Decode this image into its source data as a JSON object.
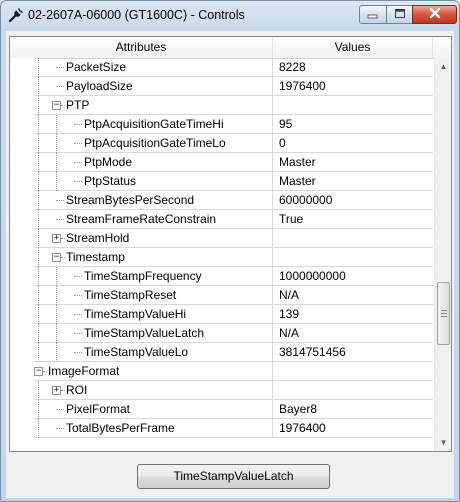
{
  "window": {
    "title": "02-2607A-06000 (GT1600C) - Controls",
    "icon": "wrench-icon",
    "controls": [
      "minimize-icon",
      "maximize-icon",
      "close-icon"
    ],
    "accent_color": "#c7d6ea",
    "close_color": "#c8412a"
  },
  "grid": {
    "columns": [
      "Attributes",
      "Values"
    ],
    "rows": [
      {
        "name": "PacketSize",
        "value": "8228",
        "level": 1,
        "expander": "none"
      },
      {
        "name": "PayloadSize",
        "value": "1976400",
        "level": 1,
        "expander": "none"
      },
      {
        "name": "PTP",
        "value": "",
        "level": 1,
        "expander": "minus"
      },
      {
        "name": "PtpAcquisitionGateTimeHi",
        "value": "95",
        "level": 2,
        "expander": "none"
      },
      {
        "name": "PtpAcquisitionGateTimeLo",
        "value": "0",
        "level": 2,
        "expander": "none"
      },
      {
        "name": "PtpMode",
        "value": "Master",
        "level": 2,
        "expander": "none"
      },
      {
        "name": "PtpStatus",
        "value": "Master",
        "level": 2,
        "expander": "none"
      },
      {
        "name": "StreamBytesPerSecond",
        "value": "60000000",
        "level": 1,
        "expander": "none"
      },
      {
        "name": "StreamFrameRateConstrain",
        "value": "True",
        "level": 1,
        "expander": "none"
      },
      {
        "name": "StreamHold",
        "value": "",
        "level": 1,
        "expander": "plus"
      },
      {
        "name": "Timestamp",
        "value": "",
        "level": 1,
        "expander": "minus"
      },
      {
        "name": "TimeStampFrequency",
        "value": "1000000000",
        "level": 2,
        "expander": "none"
      },
      {
        "name": "TimeStampReset",
        "value": "N/A",
        "level": 2,
        "expander": "none"
      },
      {
        "name": "TimeStampValueHi",
        "value": "139",
        "level": 2,
        "expander": "none"
      },
      {
        "name": "TimeStampValueLatch",
        "value": "N/A",
        "level": 2,
        "expander": "none"
      },
      {
        "name": "TimeStampValueLo",
        "value": "3814751456",
        "level": 2,
        "expander": "none"
      },
      {
        "name": "ImageFormat",
        "value": "",
        "level": 0,
        "expander": "minus"
      },
      {
        "name": "ROI",
        "value": "",
        "level": 1,
        "expander": "plus"
      },
      {
        "name": "PixelFormat",
        "value": "Bayer8",
        "level": 1,
        "expander": "none"
      },
      {
        "name": "TotalBytesPerFrame",
        "value": "1976400",
        "level": 1,
        "expander": "none"
      }
    ]
  },
  "scrollbar": {
    "up_icon": "scroll-up-arrow-icon",
    "down_icon": "scroll-down-arrow-icon",
    "position_fraction": 0.6
  },
  "action_button": {
    "label": "TimeStampValueLatch"
  }
}
